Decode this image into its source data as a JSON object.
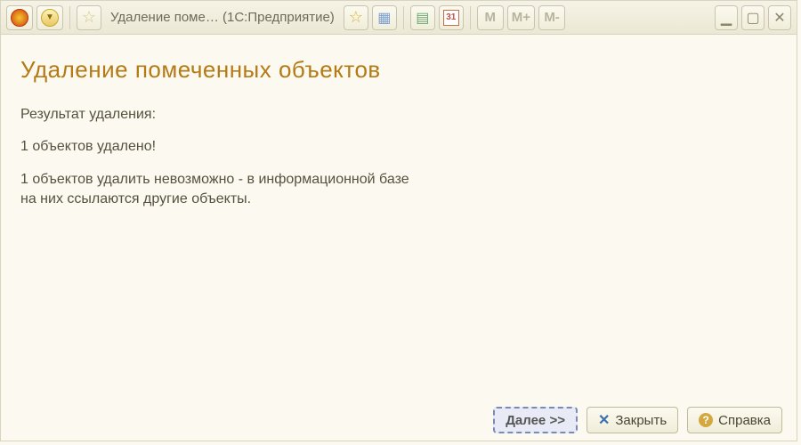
{
  "titlebar": {
    "app_title_truncated": "Удаление поме…",
    "app_context": "(1С:Предприятие)",
    "memory_buttons": {
      "m": "M",
      "m_plus": "M+",
      "m_minus": "M-"
    }
  },
  "page": {
    "heading": "Удаление помеченных объектов",
    "result_label": "Результат удаления:",
    "deleted_line": "1 объектов удалено!",
    "cannot_delete_block": "1 объектов удалить невозможно - в информационной базе\nна них ссылаются другие объекты."
  },
  "footer": {
    "next_label": "Далее >>",
    "close_label": "Закрыть",
    "help_label": "Справка"
  }
}
